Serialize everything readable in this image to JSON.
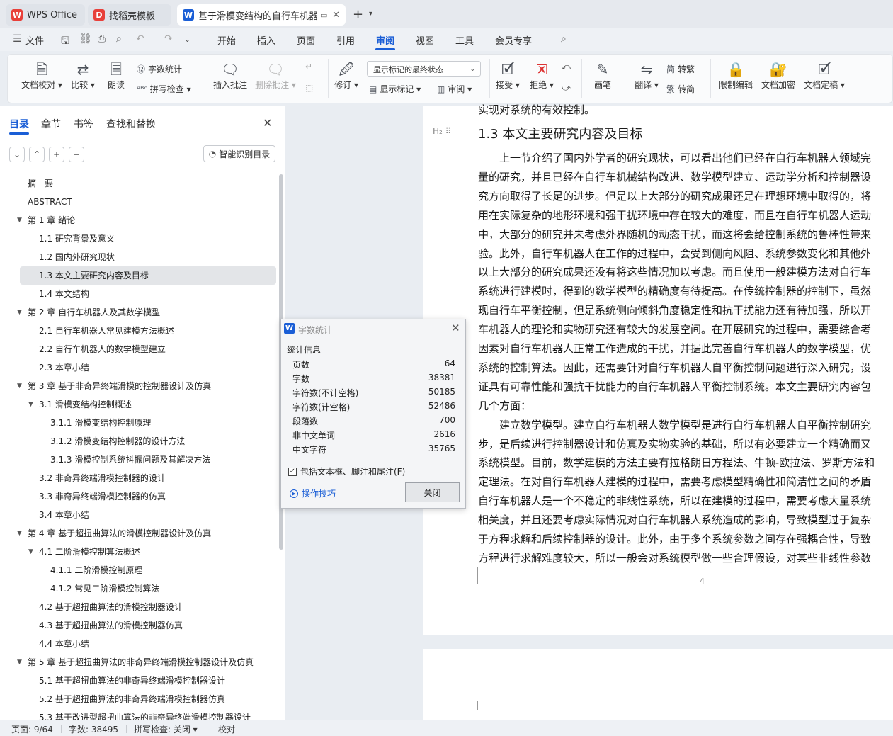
{
  "tabs": [
    {
      "label": "WPS Office",
      "icon": "wps-logo-icon",
      "color": "#e8403a"
    },
    {
      "label": "找稻壳模板",
      "icon": "docer-icon",
      "color": "#e8403a"
    },
    {
      "label": "基于滑模变结构的自行车机器人",
      "icon": "writer-icon",
      "color": "#1a5ed6"
    }
  ],
  "menu": {
    "file": "文件",
    "items": [
      "开始",
      "插入",
      "页面",
      "引用",
      "审阅",
      "视图",
      "工具",
      "会员专享"
    ],
    "active": "审阅"
  },
  "ribbon": {
    "doc_check": "文档校对",
    "compare": "比较",
    "read_aloud": "朗读",
    "word_count": "字数统计",
    "spell_check": "拼写检查",
    "insert_comment": "插入批注",
    "delete_comment": "删除批注",
    "revise": "修订",
    "markup_select": "显示标记的最终状态",
    "show_markup": "显示标记",
    "review": "审阅",
    "accept": "接受",
    "reject": "拒绝",
    "pen": "画笔",
    "translate": "翻译",
    "to_traditional": "转繁",
    "to_simplified": "转简",
    "restrict_edit": "限制编辑",
    "doc_encrypt": "文档加密",
    "doc_finalize": "文档定稿"
  },
  "sidebar": {
    "tabs": [
      "目录",
      "章节",
      "书签",
      "查找和替换"
    ],
    "smart_toc": "智能识别目录",
    "toc": [
      {
        "text": "摘　要",
        "level": 0,
        "caret": false
      },
      {
        "text": "ABSTRACT",
        "level": 0,
        "caret": false
      },
      {
        "text": "第 1 章  绪论",
        "level": 0,
        "caret": true
      },
      {
        "text": "1.1  研究背景及意义",
        "level": 1,
        "caret": false
      },
      {
        "text": "1.2  国内外研究现状",
        "level": 1,
        "caret": false
      },
      {
        "text": "1.3  本文主要研究内容及目标",
        "level": 1,
        "caret": false,
        "selected": true
      },
      {
        "text": "1.4  本文结构",
        "level": 1,
        "caret": false
      },
      {
        "text": "第 2 章  自行车机器人及其数学模型",
        "level": 0,
        "caret": true
      },
      {
        "text": "2.1  自行车机器人常见建模方法概述",
        "level": 1,
        "caret": false
      },
      {
        "text": "2.2  自行车机器人的数学模型建立",
        "level": 1,
        "caret": false
      },
      {
        "text": "2.3  本章小结",
        "level": 1,
        "caret": false
      },
      {
        "text": "第 3 章  基于非奇异终端滑模的控制器设计及仿真",
        "level": 0,
        "caret": true
      },
      {
        "text": "3.1  滑模变结构控制概述",
        "level": 1,
        "caret": true
      },
      {
        "text": "3.1.1 滑模变结构控制原理",
        "level": 2,
        "caret": false
      },
      {
        "text": "3.1.2  滑模变结构控制器的设计方法",
        "level": 2,
        "caret": false
      },
      {
        "text": "3.1.3 滑模控制系统抖振问题及其解决方法",
        "level": 2,
        "caret": false
      },
      {
        "text": "3.2  非奇异终端滑模控制器的设计",
        "level": 1,
        "caret": false
      },
      {
        "text": "3.3  非奇异终端滑模控制器的仿真",
        "level": 1,
        "caret": false
      },
      {
        "text": "3.4  本章小结",
        "level": 1,
        "caret": false
      },
      {
        "text": "第 4 章  基于超扭曲算法的滑模控制器设计及仿真",
        "level": 0,
        "caret": true
      },
      {
        "text": "4.1  二阶滑模控制算法概述",
        "level": 1,
        "caret": true
      },
      {
        "text": "4.1.1  二阶滑模控制原理",
        "level": 2,
        "caret": false
      },
      {
        "text": "4.1.2  常见二阶滑模控制算法",
        "level": 2,
        "caret": false
      },
      {
        "text": "4.2  基于超扭曲算法的滑模控制器设计",
        "level": 1,
        "caret": false
      },
      {
        "text": "4.3  基于超扭曲算法的滑模控制器仿真",
        "level": 1,
        "caret": false
      },
      {
        "text": "4.4  本章小结",
        "level": 1,
        "caret": false
      },
      {
        "text": "第 5 章  基于超扭曲算法的非奇异终端滑模控制器设计及仿真",
        "level": 0,
        "caret": true
      },
      {
        "text": "5.1  基于超扭曲算法的非奇异终端滑模控制器设计",
        "level": 1,
        "caret": false
      },
      {
        "text": "5.2  基于超扭曲算法的非奇异终端滑模控制器仿真",
        "level": 1,
        "caret": false
      },
      {
        "text": "5.3  基于改进型超扭曲算法的非奇异终端滑模控制器设计",
        "level": 1,
        "caret": false
      }
    ]
  },
  "document": {
    "top_partial": "实现对系统的有效控制。",
    "heading": "1.3  本文主要研究内容及目标",
    "heading_marker": "H₂",
    "lines": [
      "　　上一节介绍了国内外学者的研究现状，可以看出他们已经在自行车机器人领域完",
      "量的研究，并且已经在自行车机械结构改进、数学模型建立、运动学分析和控制器设",
      "究方向取得了长足的进步。但是以上大部分的研究成果还是在理想环境中取得的，将",
      "用在实际复杂的地形环境和强干扰环境中存在较大的难度，而且在自行车机器人运动",
      "中，大部分的研究并未考虑外界随机的动态干扰，而这将会给控制系统的鲁棒性带来",
      "验。此外，自行车机器人在工作的过程中，会受到侧向风阻、系统参数变化和其他外",
      "以上大部分的研究成果还没有将这些情况加以考虑。而且使用一般建模方法对自行车",
      "系统进行建模时，得到的数学模型的精确度有待提高。在传统控制器的控制下，虽然",
      "现自行车平衡控制，但是系统侧向倾斜角度稳定性和抗干扰能力还有待加强，所以开",
      "车机器人的理论和实物研究还有较大的发展空间。在开展研究的过程中，需要综合考",
      "因素对自行车机器人正常工作造成的干扰，并据此完善自行车机器人的数学模型，优",
      "系统的控制算法。因此，还需要针对自行车机器人自平衡控制问题进行深入研究，设",
      "证具有可靠性能和强抗干扰能力的自行车机器人平衡控制系统。本文主要研究内容包",
      "几个方面：",
      "　　建立数学模型。建立自行车机器人数学模型是进行自行车机器人自平衡控制研究",
      "步，是后续进行控制器设计和仿真及实物实验的基础，所以有必要建立一个精确而又",
      "系统模型。目前，数学建模的方法主要有拉格朗日方程法、牛顿-欧拉法、罗斯方法和",
      "定理法。在对自行车机器人建模的过程中，需要考虑模型精确性和简洁性之间的矛盾",
      "自行车机器人是一个不稳定的非线性系统，所以在建模的过程中，需要考虑大量系统",
      "相关度，并且还要考虑实际情况对自行车机器人系统造成的影响，导致模型过于复杂",
      "于方程求解和后续控制器的设计。此外，由于多个系统参数之间存在强耦合性，导致",
      "方程进行求解难度较大，所以一般会对系统模型做一些合理假设，对某些非线性参数"
    ],
    "page_number": "4"
  },
  "dialog": {
    "title": "字数统计",
    "section": "统计信息",
    "stats": [
      {
        "label": "页数",
        "value": "64"
      },
      {
        "label": "字数",
        "value": "38381"
      },
      {
        "label": "字符数(不计空格)",
        "value": "50185"
      },
      {
        "label": "字符数(计空格)",
        "value": "52486"
      },
      {
        "label": "段落数",
        "value": "700"
      },
      {
        "label": "非中文单词",
        "value": "2616"
      },
      {
        "label": "中文字符",
        "value": "35765"
      }
    ],
    "checkbox_label": "包括文本框、脚注和尾注(F)",
    "checkbox_checked": true,
    "tips": "操作技巧",
    "close": "关闭"
  },
  "status": {
    "page": "页面: 9/64",
    "words": "字数: 38495",
    "spell": "拼写检查: 关闭",
    "proof": "校对"
  }
}
